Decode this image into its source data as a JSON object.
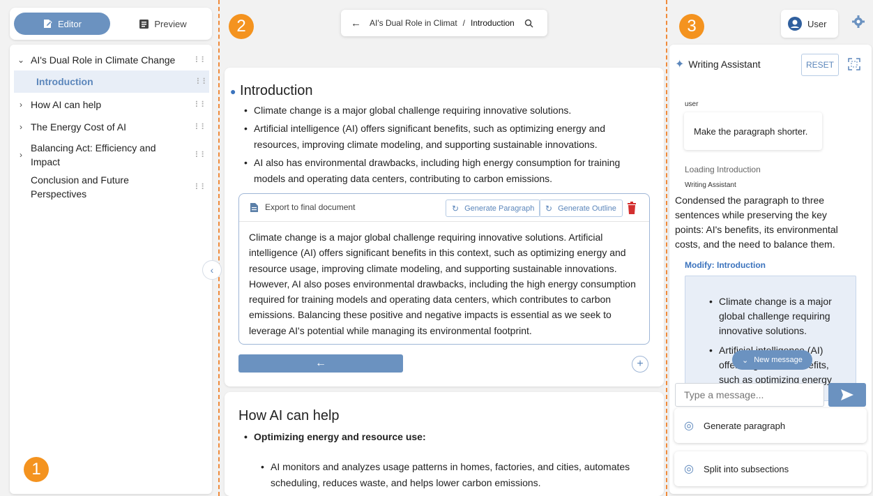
{
  "badges": [
    "1",
    "2",
    "3"
  ],
  "mode_toggle": {
    "editor": "Editor",
    "preview": "Preview"
  },
  "outline": {
    "root": "AI's Dual Role in Climate Change",
    "items": [
      {
        "label": "Introduction",
        "active": true
      },
      {
        "label": "How AI can help"
      },
      {
        "label": "The Energy Cost of AI"
      },
      {
        "label": "Balancing Act: Efficiency and Impact"
      },
      {
        "label": "Conclusion and Future Perspectives"
      }
    ]
  },
  "breadcrumb": {
    "parent": "AI's Dual Role in Climat",
    "separator": "/",
    "current": "Introduction"
  },
  "section1": {
    "title": "Introduction",
    "bullets": [
      "Climate change is a major global challenge requiring innovative solutions.",
      "Artificial intelligence (AI) offers significant benefits, such as optimizing energy and resources, improving climate modeling, and supporting sustainable innovations.",
      "AI also has environmental drawbacks, including high energy consumption for training models and operating data centers, contributing to carbon emissions."
    ],
    "export_label": "Export to final document",
    "generate_paragraph": "Generate Paragraph",
    "generate_outline": "Generate Outline",
    "paragraph": "Climate change is a major global challenge requiring innovative solutions. Artificial intelligence (AI) offers significant benefits in this context, such as optimizing energy and resource usage, improving climate modeling, and supporting sustainable innovations. However, AI also poses environmental drawbacks, including the high energy consumption required for training models and operating data centers, which contributes to carbon emissions. Balancing these positive and negative impacts is essential as we seek to leverage AI's potential while managing its environmental footprint."
  },
  "section2": {
    "title": "How AI can help",
    "bullet_bold": "Optimizing energy and resource use:",
    "sub_bullet": "AI monitors and analyzes usage patterns in homes, factories, and cities, automates scheduling, reduces waste, and helps lower carbon emissions."
  },
  "header_right": {
    "user": "User"
  },
  "assistant": {
    "title": "Writing Assistant",
    "reset": "RESET",
    "user_role": "user",
    "user_message": "Make the paragraph shorter.",
    "loading": "Loading Introduction",
    "assistant_role": "Writing Assistant",
    "response": "Condensed the paragraph to three sentences while preserving the key points: AI's benefits, its environmental costs, and the need to balance them.",
    "modify_label": "Modify: Introduction",
    "modify_bullets": [
      "Climate change is a major global challenge requiring innovative solutions.",
      "Artificial intelligence (AI) offers significant benefits, such as optimizing energy and"
    ],
    "new_message": "New message",
    "input_placeholder": "Type a message...",
    "actions": [
      "Generate paragraph",
      "Split into subsections"
    ]
  },
  "colors": {
    "accent": "#6b92c0",
    "badge": "#f4931f",
    "separator": "#f08a3a",
    "delete": "#d32f2f"
  }
}
